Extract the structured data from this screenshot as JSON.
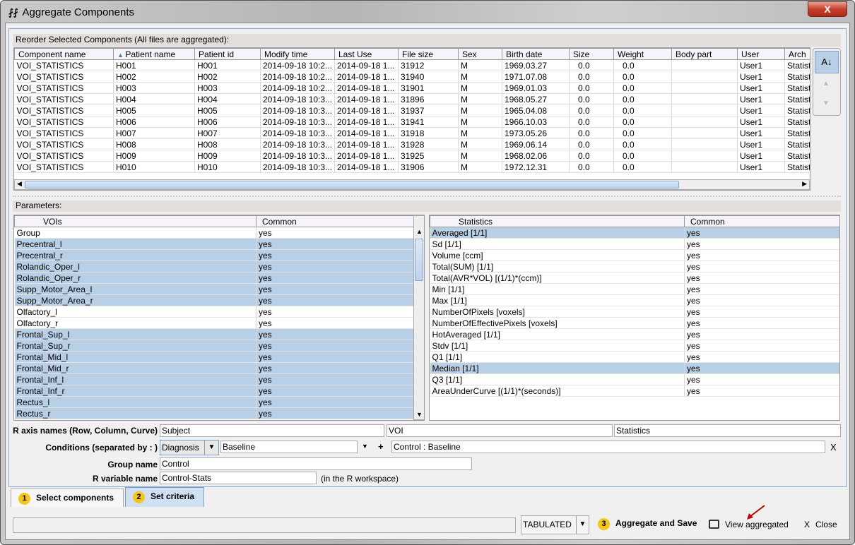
{
  "window": {
    "title": "Aggregate Components",
    "title_icon": "pmod-icon",
    "close_label": "X"
  },
  "components": {
    "section_label": "Reorder Selected Components (All files are aggregated):",
    "columns": [
      "Component name",
      "Patient name",
      "Patient id",
      "Modify time",
      "Last Use",
      "File size",
      "Sex",
      "Birth date",
      "Size",
      "Weight",
      "Body part",
      "User",
      "Arch"
    ],
    "sorted_column": "Patient name",
    "rows": [
      [
        "VOI_STATISTICS",
        "H001",
        "H001",
        "2014-09-18 10:2...",
        "2014-09-18 1...",
        "31912",
        "M",
        "1969.03.27",
        "0.0",
        "0.0",
        "",
        "User1",
        "Statist"
      ],
      [
        "VOI_STATISTICS",
        "H002",
        "H002",
        "2014-09-18 10:2...",
        "2014-09-18 1...",
        "31940",
        "M",
        "1971.07.08",
        "0.0",
        "0.0",
        "",
        "User1",
        "Statist"
      ],
      [
        "VOI_STATISTICS",
        "H003",
        "H003",
        "2014-09-18 10:2...",
        "2014-09-18 1...",
        "31901",
        "M",
        "1969.01.03",
        "0.0",
        "0.0",
        "",
        "User1",
        "Statist"
      ],
      [
        "VOI_STATISTICS",
        "H004",
        "H004",
        "2014-09-18 10:3...",
        "2014-09-18 1...",
        "31896",
        "M",
        "1968.05.27",
        "0.0",
        "0.0",
        "",
        "User1",
        "Statist"
      ],
      [
        "VOI_STATISTICS",
        "H005",
        "H005",
        "2014-09-18 10:3...",
        "2014-09-18 1...",
        "31937",
        "M",
        "1965.04.08",
        "0.0",
        "0.0",
        "",
        "User1",
        "Statist"
      ],
      [
        "VOI_STATISTICS",
        "H006",
        "H006",
        "2014-09-18 10:3...",
        "2014-09-18 1...",
        "31941",
        "M",
        "1966.10.03",
        "0.0",
        "0.0",
        "",
        "User1",
        "Statist"
      ],
      [
        "VOI_STATISTICS",
        "H007",
        "H007",
        "2014-09-18 10:3...",
        "2014-09-18 1...",
        "31918",
        "M",
        "1973.05.26",
        "0.0",
        "0.0",
        "",
        "User1",
        "Statist"
      ],
      [
        "VOI_STATISTICS",
        "H008",
        "H008",
        "2014-09-18 10:3...",
        "2014-09-18 1...",
        "31928",
        "M",
        "1969.06.14",
        "0.0",
        "0.0",
        "",
        "User1",
        "Statist"
      ],
      [
        "VOI_STATISTICS",
        "H009",
        "H009",
        "2014-09-18 10:3...",
        "2014-09-18 1...",
        "31925",
        "M",
        "1968.02.06",
        "0.0",
        "0.0",
        "",
        "User1",
        "Statist"
      ],
      [
        "VOI_STATISTICS",
        "H010",
        "H010",
        "2014-09-18 10:3...",
        "2014-09-18 1...",
        "31906",
        "M",
        "1972.12.31",
        "0.0",
        "0.0",
        "",
        "User1",
        "Statist"
      ]
    ]
  },
  "parameters": {
    "section_label": "Parameters:",
    "vois": {
      "columns": [
        "VOIs",
        "Common"
      ],
      "rows": [
        {
          "name": "Group",
          "common": "yes",
          "selected": false
        },
        {
          "name": "Precentral_l",
          "common": "yes",
          "selected": true
        },
        {
          "name": "Precentral_r",
          "common": "yes",
          "selected": true
        },
        {
          "name": "Rolandic_Oper_l",
          "common": "yes",
          "selected": true
        },
        {
          "name": "Rolandic_Oper_r",
          "common": "yes",
          "selected": true
        },
        {
          "name": "Supp_Motor_Area_l",
          "common": "yes",
          "selected": true
        },
        {
          "name": "Supp_Motor_Area_r",
          "common": "yes",
          "selected": true
        },
        {
          "name": "Olfactory_l",
          "common": "yes",
          "selected": false
        },
        {
          "name": "Olfactory_r",
          "common": "yes",
          "selected": false
        },
        {
          "name": "Frontal_Sup_l",
          "common": "yes",
          "selected": true
        },
        {
          "name": "Frontal_Sup_r",
          "common": "yes",
          "selected": true
        },
        {
          "name": "Frontal_Mid_l",
          "common": "yes",
          "selected": true
        },
        {
          "name": "Frontal_Mid_r",
          "common": "yes",
          "selected": true
        },
        {
          "name": "Frontal_Inf_l",
          "common": "yes",
          "selected": true
        },
        {
          "name": "Frontal_Inf_r",
          "common": "yes",
          "selected": true
        },
        {
          "name": "Rectus_l",
          "common": "yes",
          "selected": true
        },
        {
          "name": "Rectus_r",
          "common": "yes",
          "selected": true
        }
      ]
    },
    "statistics": {
      "columns": [
        "Statistics",
        "Common"
      ],
      "rows": [
        {
          "name": "Averaged [1/1]",
          "common": "yes",
          "selected": true
        },
        {
          "name": "Sd [1/1]",
          "common": "yes",
          "selected": false
        },
        {
          "name": "Volume [ccm]",
          "common": "yes",
          "selected": false
        },
        {
          "name": "Total(SUM) [1/1]",
          "common": "yes",
          "selected": false
        },
        {
          "name": "Total(AVR*VOL) [(1/1)*(ccm)]",
          "common": "yes",
          "selected": false
        },
        {
          "name": "Min [1/1]",
          "common": "yes",
          "selected": false
        },
        {
          "name": "Max [1/1]",
          "common": "yes",
          "selected": false
        },
        {
          "name": "NumberOfPixels [voxels]",
          "common": "yes",
          "selected": false
        },
        {
          "name": "NumberOfEffectivePixels [voxels]",
          "common": "yes",
          "selected": false
        },
        {
          "name": "HotAveraged [1/1]",
          "common": "yes",
          "selected": false
        },
        {
          "name": "Stdv [1/1]",
          "common": "yes",
          "selected": false
        },
        {
          "name": "Q1 [1/1]",
          "common": "yes",
          "selected": false
        },
        {
          "name": "Median [1/1]",
          "common": "yes",
          "selected": true
        },
        {
          "name": "Q3 [1/1]",
          "common": "yes",
          "selected": false
        },
        {
          "name": "AreaUnderCurve [(1/1)*(seconds)]",
          "common": "yes",
          "selected": false
        }
      ]
    }
  },
  "form": {
    "axis_label": "R axis names (Row, Column, Curve)",
    "axis_row": "Subject",
    "axis_column": "VOI",
    "axis_curve": "Statistics",
    "conditions_label": "Conditions (separated by : )",
    "condition_field": "Diagnosis",
    "condition_value": "Baseline",
    "plus": "+",
    "condition_result": "Control : Baseline",
    "remove": "X",
    "group_label": "Group name",
    "group_value": "Control",
    "rvar_label": "R variable name",
    "rvar_value": "Control-Stats",
    "rvar_note": "(in the R workspace)"
  },
  "tabs": [
    {
      "num": "1",
      "label": "Select components"
    },
    {
      "num": "2",
      "label": "Set criteria"
    }
  ],
  "footer": {
    "format": "TABULATED",
    "aggregate_num": "3",
    "aggregate_label": "Aggregate and Save",
    "view_label": "View aggregated",
    "close_label": "Close",
    "close_icon": "X"
  },
  "colors": {
    "selection": "#b8cfe5",
    "badge": "#f5c518",
    "active_tab": "#cfe0f3"
  }
}
